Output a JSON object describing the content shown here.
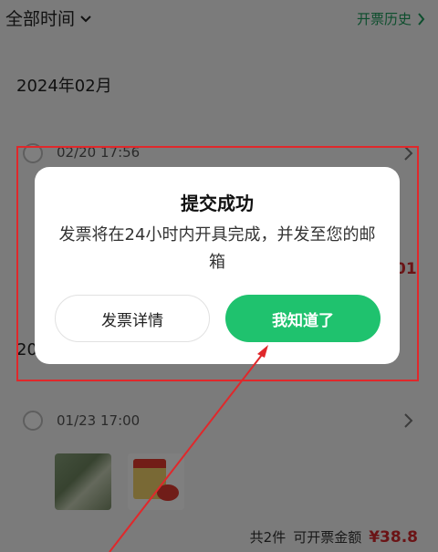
{
  "header": {
    "filter_label": "全部时间",
    "history_label": "开票历史"
  },
  "month_header": "2024年02月",
  "orders": [
    {
      "time": "02/20 17:56"
    },
    {
      "time": "01/23 17:00"
    }
  ],
  "partial_month_label": "20",
  "partial_amount": "01",
  "summary": {
    "count_label": "共2件",
    "amount_label": "可开票金额",
    "amount": "¥38.8"
  },
  "dialog": {
    "title": "提交成功",
    "message": "发票将在24小时内开具完成，并发至您的邮箱",
    "detail_button": "发票详情",
    "confirm_button": "我知道了"
  },
  "colors": {
    "accent_green": "#1fc26e",
    "price_red": "#d6282d",
    "annotation_red": "#e0282b"
  },
  "icons": [
    "chevron-down-icon",
    "chevron-right-icon",
    "radio-icon"
  ]
}
